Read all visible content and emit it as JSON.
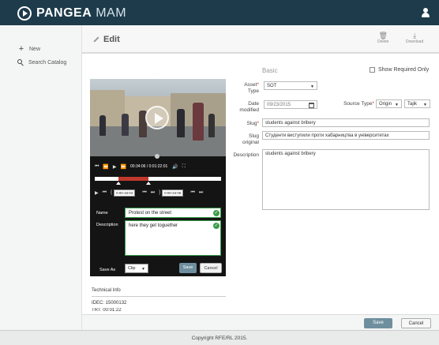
{
  "header": {
    "brand_bold": "PANGEA",
    "brand_light": "MAM"
  },
  "sidebar": {
    "items": [
      {
        "label": "New",
        "icon": "plus-icon"
      },
      {
        "label": "Search Catalog",
        "icon": "search-icon"
      }
    ]
  },
  "toolbar": {
    "title": "Edit",
    "delete_label": "Delete",
    "download_label": "Download"
  },
  "player": {
    "timecode": "00:34:06 / 0:01:22:01",
    "trim_in": "0:00:18:02",
    "trim_out": "0:00:34:06",
    "name_label": "Name",
    "name_value": "Protest on the street",
    "description_label": "Description",
    "description_value": "here they get toguether",
    "save_as_label": "Save As",
    "save_as_value": "Clip",
    "save_label": "Save",
    "cancel_label": "Cancel"
  },
  "technical": {
    "title": "Technical Info",
    "idec": "IDEC: 15000132",
    "trt": "TRT: 00:01:22"
  },
  "form": {
    "section_title": "Basic",
    "show_required_label": "Show Required Only",
    "asset_type_label_1": "Asset",
    "asset_type_label_2": "Type",
    "asset_type_value": "SOT",
    "date_label_1": "Date",
    "date_label_2": "modified",
    "date_value": "09/23/2015",
    "source_type_label": "Source Type",
    "source_type_value_1": "Origin",
    "source_type_value_2": "Tajik",
    "slug_label": "Slug",
    "slug_value": "students against bribery",
    "slug_original_label_1": "Slug",
    "slug_original_label_2": "original",
    "slug_original_value": "Студенти виступили проти хабарництва в університетах",
    "description_label": "Description",
    "description_value": "students against bribery"
  },
  "bottom": {
    "save_label": "Save",
    "cancel_label": "Cancel"
  },
  "footer": {
    "copyright": "Copyright RFE/RL 2015."
  },
  "colors": {
    "header_bg": "#1d3b4b",
    "accent_green": "#3a9c4a",
    "selection_red": "#c0392b",
    "primary_button": "#6f8f9f"
  }
}
